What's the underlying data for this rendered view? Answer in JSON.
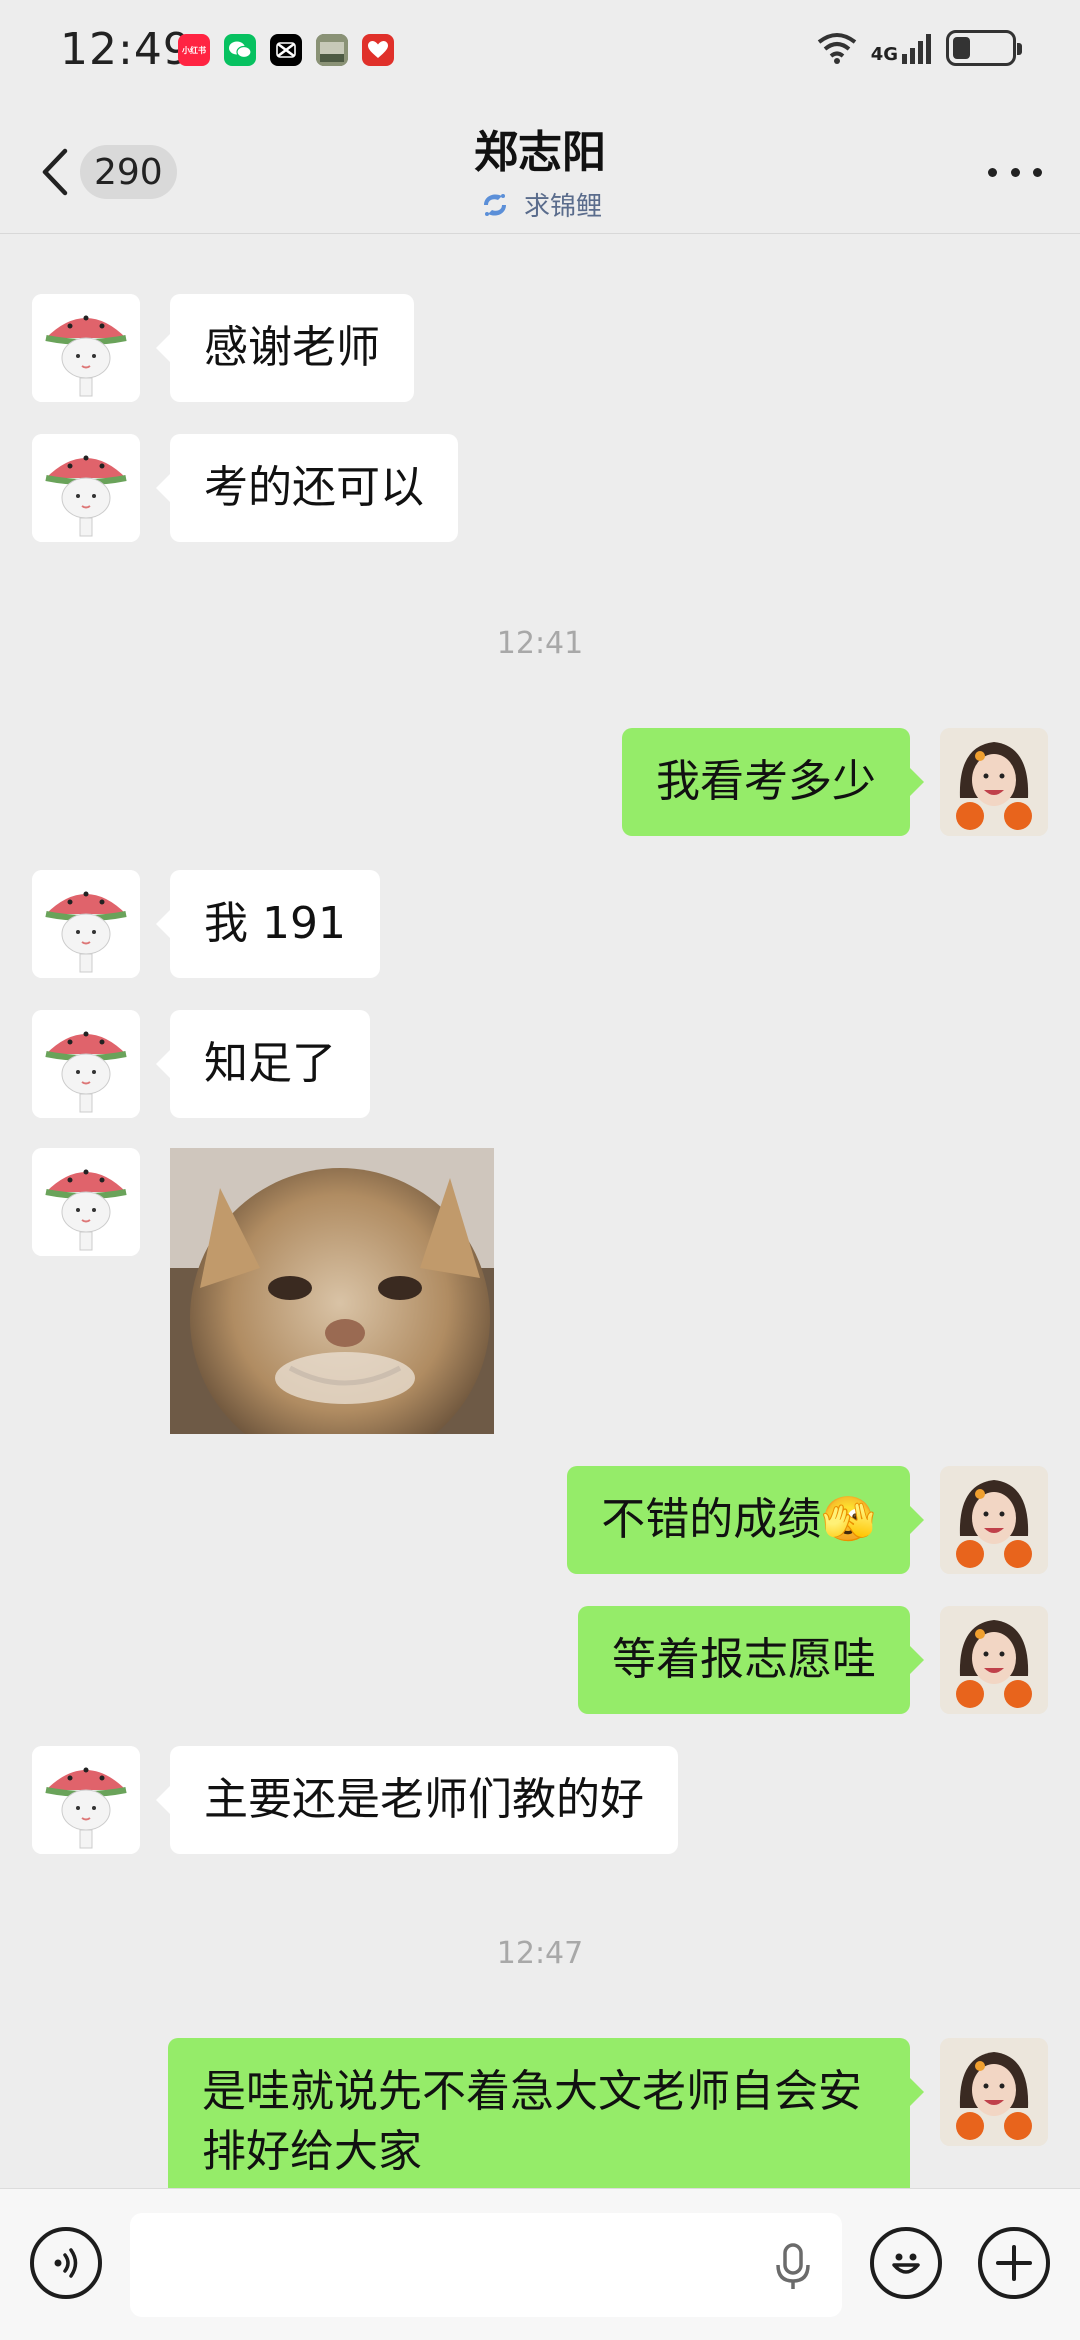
{
  "status_bar": {
    "time": "12:49",
    "network": "4G",
    "notification_icons": [
      {
        "name": "red-app-icon",
        "label": "小红书",
        "color": "#ff2442"
      },
      {
        "name": "wechat-icon",
        "label": "",
        "color": "#07c160"
      },
      {
        "name": "capcut-icon",
        "label": "",
        "color": "#000000"
      },
      {
        "name": "photo-thumb-icon",
        "label": "",
        "color": "#6b7a5a"
      },
      {
        "name": "heart-app-icon",
        "label": "",
        "color": "#e0302a"
      }
    ],
    "battery_level": 0.3
  },
  "header": {
    "back_count": "290",
    "title": "郑志阳",
    "status": "求锦鲤"
  },
  "messages": [
    {
      "side": "other",
      "type": "text",
      "text": "感谢老师"
    },
    {
      "side": "other",
      "type": "text",
      "text": "考的还可以"
    },
    {
      "type": "time",
      "text": "12:41"
    },
    {
      "side": "mine",
      "type": "text",
      "text": "我看考多少"
    },
    {
      "side": "other",
      "type": "text",
      "text": "我 191"
    },
    {
      "side": "other",
      "type": "text",
      "text": "知足了"
    },
    {
      "side": "other",
      "type": "image",
      "text": ""
    },
    {
      "side": "mine",
      "type": "text",
      "text": "不错的成绩",
      "emoji": "🫣"
    },
    {
      "side": "mine",
      "type": "text",
      "text": "等着报志愿哇"
    },
    {
      "side": "other",
      "type": "text",
      "text": "主要还是老师们教的好"
    },
    {
      "type": "time",
      "text": "12:47"
    },
    {
      "side": "mine",
      "type": "text",
      "text": "是哇就说先不着急大文老师自会安排好给大家"
    }
  ],
  "input": {
    "placeholder": ""
  },
  "colors": {
    "background": "#ededed",
    "bubble_mine": "#95ec69",
    "bubble_other": "#ffffff",
    "status_accent": "#5a6c8c"
  }
}
